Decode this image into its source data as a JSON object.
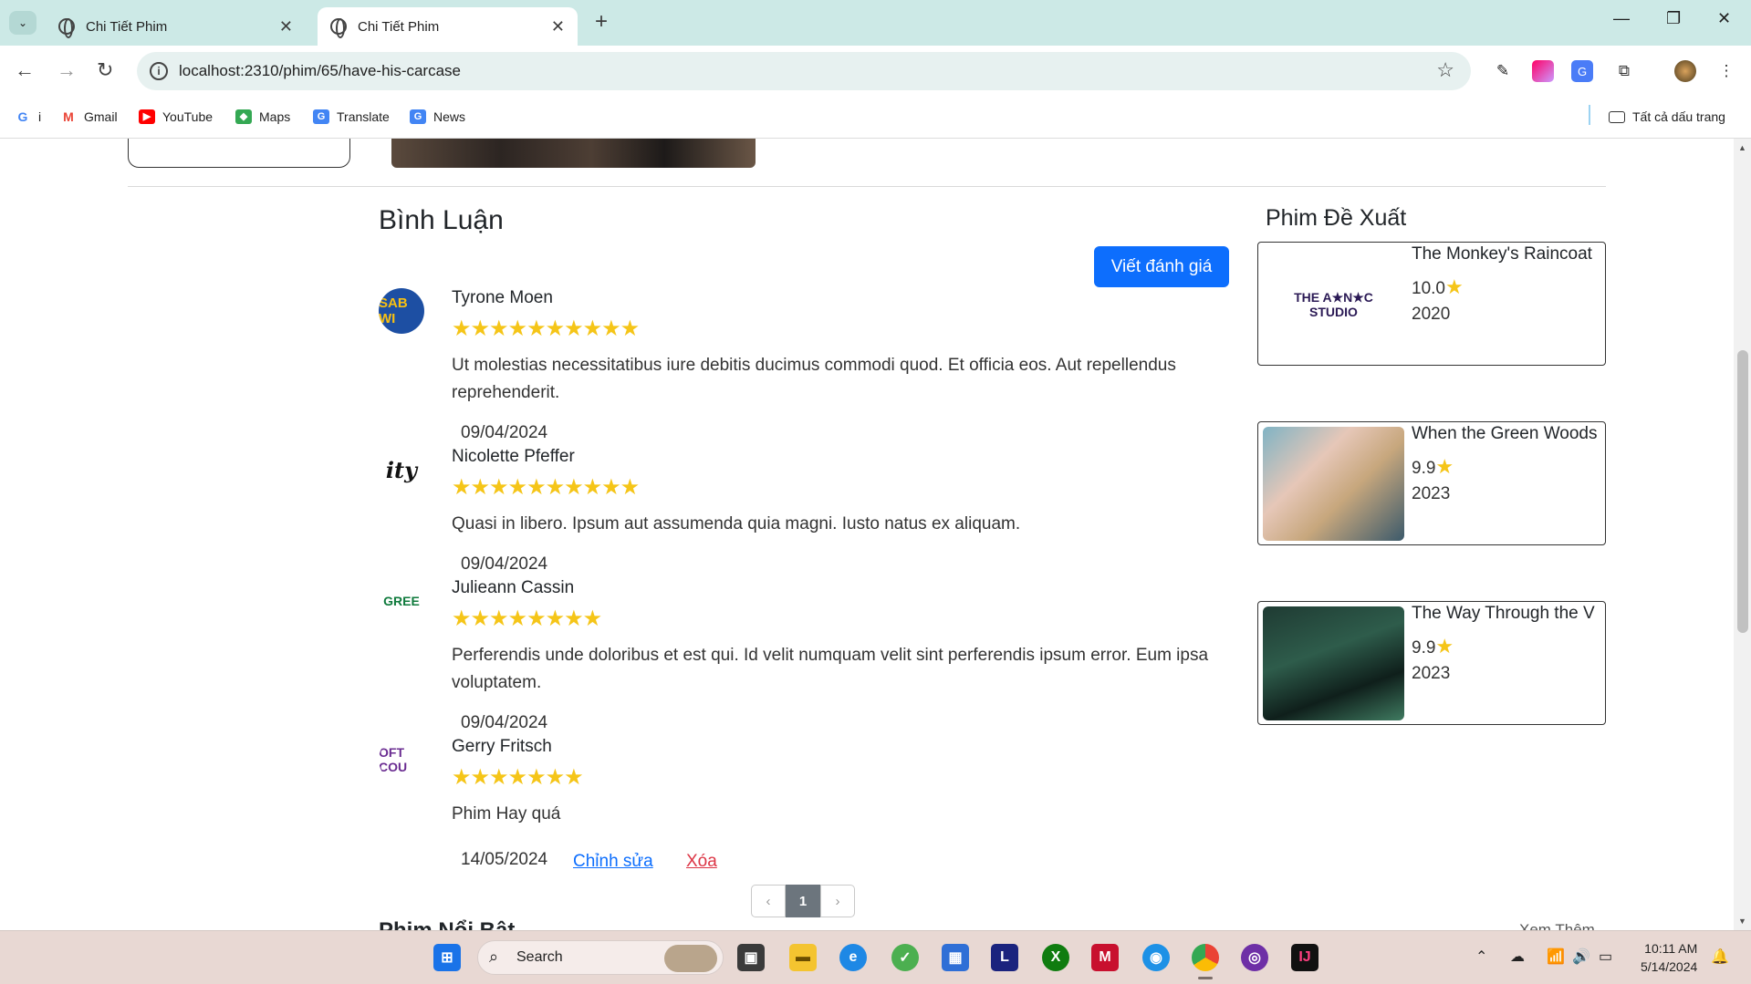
{
  "browser": {
    "tabs": [
      {
        "title": "Chi Tiết Phim",
        "active": false
      },
      {
        "title": "Chi Tiết Phim",
        "active": true
      }
    ],
    "new_tab": "+",
    "url": "localhost:2310/phim/65/have-his-carcase",
    "bookmarks": [
      {
        "label": "i",
        "icon": "google-icon"
      },
      {
        "label": "Gmail",
        "icon": "gmail-icon"
      },
      {
        "label": "YouTube",
        "icon": "youtube-icon"
      },
      {
        "label": "Maps",
        "icon": "maps-icon"
      },
      {
        "label": "Translate",
        "icon": "translate-icon"
      },
      {
        "label": "News",
        "icon": "news-icon"
      }
    ],
    "all_bookmarks": "Tất cả dấu trang"
  },
  "comments": {
    "title": "Bình Luận",
    "write_button": "Viết đánh giá",
    "items": [
      {
        "name": "Tyrone Moen",
        "stars": 10,
        "stars_text": "★★★★★★★★★★",
        "text": "Ut molestias necessitatibus iure debitis ducimus commodi quod. Et officia eos. Aut repellendus reprehenderit.",
        "date": "09/04/2024",
        "avatar_text": "SAB WI"
      },
      {
        "name": "Nicolette Pfeffer",
        "stars": 10,
        "stars_text": "★★★★★★★★★★",
        "text": "Quasi in libero. Ipsum aut assumenda quia magni. Iusto natus ex aliquam.",
        "date": "09/04/2024",
        "avatar_text": "ity"
      },
      {
        "name": "Julieann Cassin",
        "stars": 8,
        "stars_text": "★★★★★★★★",
        "text": "Perferendis unde doloribus et est qui. Id velit numquam velit sint perferendis ipsum error. Eum ipsa voluptatem.",
        "date": "09/04/2024",
        "avatar_text": "GREE"
      },
      {
        "name": "Gerry Fritsch",
        "stars": 7,
        "stars_text": "★★★★★★★",
        "text": "Phim Hay quá",
        "date": "14/05/2024",
        "avatar_text": "OFT COU"
      }
    ],
    "edit_link": "Chỉnh sửa",
    "delete_link": "Xóa",
    "pagination": {
      "prev": "‹",
      "current": "1",
      "next": "›"
    }
  },
  "suggestions": {
    "title": "Phim Đề Xuất",
    "items": [
      {
        "title": "The Monkey's Raincoat",
        "rating": "10.0",
        "year": "2020",
        "poster_text": "THE A★N★C STUDIO"
      },
      {
        "title": "When the Green Woods",
        "rating": "9.9",
        "year": "2023"
      },
      {
        "title": "The Way Through the V",
        "rating": "9.9",
        "year": "2023"
      }
    ]
  },
  "next_section": {
    "title": "Phim Nổi Bật",
    "see_more": "Xem Thêm"
  },
  "taskbar": {
    "search_label": "Search",
    "time": "10:11 AM",
    "date": "5/14/2024"
  },
  "colors": {
    "accent": "#0d6efd",
    "star": "#f5c518",
    "danger": "#dc3545",
    "tabbar": "#cce9e6"
  }
}
